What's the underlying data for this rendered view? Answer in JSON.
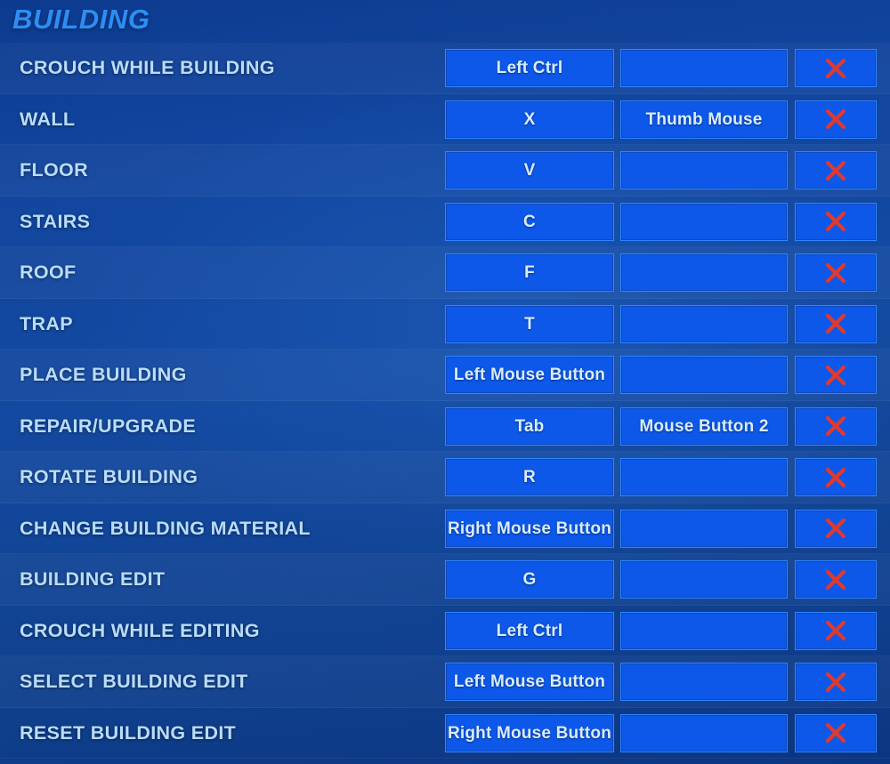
{
  "section": {
    "title": "BUILDING"
  },
  "columns": {
    "action_header": "",
    "primary_header": "",
    "secondary_header": "",
    "reset_header": ""
  },
  "reset_icon": "close-x-icon",
  "colors": {
    "accent_heading": "#2f8df2",
    "label_text": "#b9dcfb",
    "cell_background": "#0d58e8",
    "cell_border": "#2f86ff",
    "cell_text": "#d8ecff",
    "reset_x": "#e0392e",
    "page_background": "#11459e"
  },
  "bindings": [
    {
      "action": "CROUCH WHILE BUILDING",
      "primary": "Left Ctrl",
      "secondary": "",
      "reset": "×"
    },
    {
      "action": "WALL",
      "primary": "X",
      "secondary": "Thumb Mouse",
      "reset": "×"
    },
    {
      "action": "FLOOR",
      "primary": "V",
      "secondary": "",
      "reset": "×"
    },
    {
      "action": "STAIRS",
      "primary": "C",
      "secondary": "",
      "reset": "×"
    },
    {
      "action": "ROOF",
      "primary": "F",
      "secondary": "",
      "reset": "×"
    },
    {
      "action": "TRAP",
      "primary": "T",
      "secondary": "",
      "reset": "×"
    },
    {
      "action": "PLACE BUILDING",
      "primary": "Left Mouse Button",
      "secondary": "",
      "reset": "×"
    },
    {
      "action": "REPAIR/UPGRADE",
      "primary": "Tab",
      "secondary": "Mouse Button 2",
      "reset": "×"
    },
    {
      "action": "ROTATE BUILDING",
      "primary": "R",
      "secondary": "",
      "reset": "×"
    },
    {
      "action": "CHANGE BUILDING MATERIAL",
      "primary": "Right Mouse Button",
      "secondary": "",
      "reset": "×"
    },
    {
      "action": "BUILDING EDIT",
      "primary": "G",
      "secondary": "",
      "reset": "×"
    },
    {
      "action": "CROUCH WHILE EDITING",
      "primary": "Left Ctrl",
      "secondary": "",
      "reset": "×"
    },
    {
      "action": "SELECT BUILDING EDIT",
      "primary": "Left Mouse Button",
      "secondary": "",
      "reset": "×"
    },
    {
      "action": "RESET BUILDING EDIT",
      "primary": "Right Mouse Button",
      "secondary": "",
      "reset": "×"
    }
  ]
}
